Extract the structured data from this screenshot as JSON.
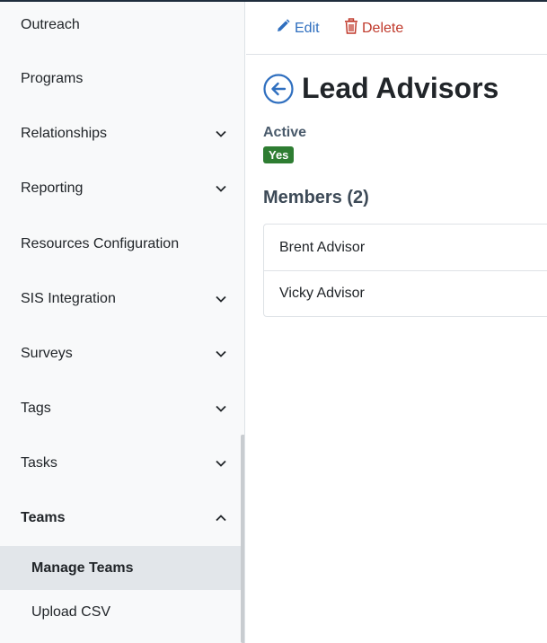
{
  "sidebar": {
    "items": [
      {
        "label": "Outreach",
        "chevron": "none"
      },
      {
        "label": "Programs",
        "chevron": "none"
      },
      {
        "label": "Relationships",
        "chevron": "down"
      },
      {
        "label": "Reporting",
        "chevron": "down"
      },
      {
        "label": "Resources Configuration",
        "chevron": "none"
      },
      {
        "label": "SIS Integration",
        "chevron": "down"
      },
      {
        "label": "Surveys",
        "chevron": "down"
      },
      {
        "label": "Tags",
        "chevron": "down"
      },
      {
        "label": "Tasks",
        "chevron": "down"
      },
      {
        "label": "Teams",
        "chevron": "up",
        "expanded": true
      }
    ],
    "subitems": [
      {
        "label": "Manage Teams",
        "active": true
      },
      {
        "label": "Upload CSV",
        "active": false
      }
    ]
  },
  "toolbar": {
    "edit_label": "Edit",
    "delete_label": "Delete"
  },
  "page": {
    "title": "Lead Advisors",
    "active_label": "Active",
    "active_value": "Yes",
    "members_heading": "Members (2)",
    "members": [
      "Brent Advisor",
      "Vicky Advisor"
    ]
  },
  "colors": {
    "edit": "#2f6fbf",
    "delete": "#c0392b",
    "badge": "#2e7d32",
    "sidebar_active": "#e2e6ea"
  }
}
